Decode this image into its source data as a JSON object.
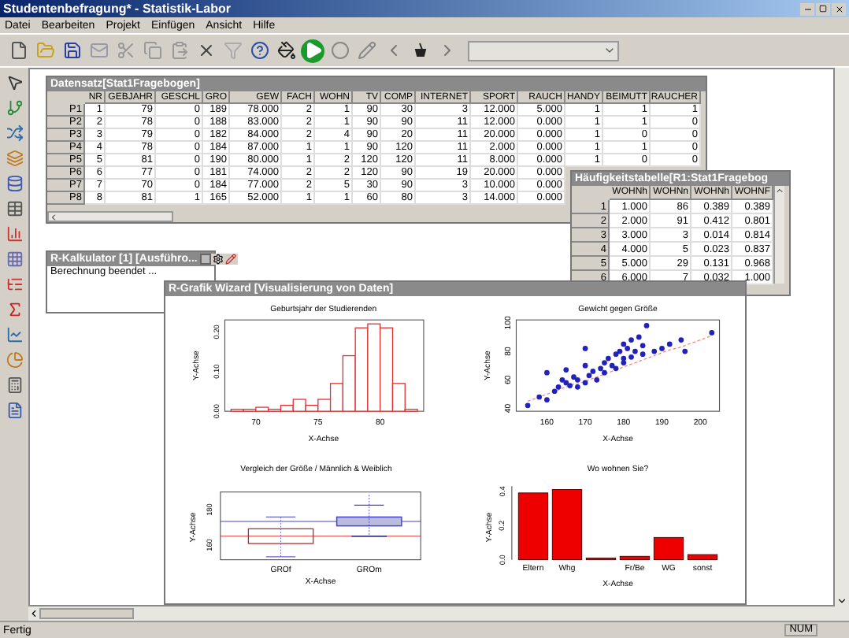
{
  "window": {
    "title": "Studentenbefragung* - Statistik-Labor"
  },
  "menu": [
    "Datei",
    "Bearbeiten",
    "Projekt",
    "Einfügen",
    "Ansicht",
    "Hilfe"
  ],
  "dataset": {
    "title": "Datensatz[Stat1Fragebogen]",
    "columns": [
      "NR",
      "GEBJAHR",
      "GESCHL",
      "GRO",
      "GEW",
      "FACH",
      "WOHN",
      "TV",
      "COMP",
      "INTERNET",
      "SPORT",
      "RAUCH",
      "HANDY",
      "BEIMUTT",
      "RAUCHER"
    ],
    "rows": [
      {
        "label": "P1",
        "cells": [
          "1",
          "79",
          "0",
          "189",
          "78.000",
          "2",
          "1",
          "90",
          "30",
          "3",
          "12.000",
          "5.000",
          "1",
          "1",
          "1"
        ]
      },
      {
        "label": "P2",
        "cells": [
          "2",
          "78",
          "0",
          "188",
          "83.000",
          "2",
          "1",
          "90",
          "90",
          "11",
          "12.000",
          "0.000",
          "1",
          "1",
          "0"
        ]
      },
      {
        "label": "P3",
        "cells": [
          "3",
          "79",
          "0",
          "182",
          "84.000",
          "2",
          "4",
          "90",
          "20",
          "11",
          "20.000",
          "0.000",
          "1",
          "0",
          "0"
        ]
      },
      {
        "label": "P4",
        "cells": [
          "4",
          "78",
          "0",
          "184",
          "87.000",
          "1",
          "1",
          "90",
          "120",
          "11",
          "2.000",
          "0.000",
          "1",
          "1",
          "0"
        ]
      },
      {
        "label": "P5",
        "cells": [
          "5",
          "81",
          "0",
          "190",
          "80.000",
          "1",
          "2",
          "120",
          "120",
          "11",
          "8.000",
          "0.000",
          "1",
          "0",
          "0"
        ]
      },
      {
        "label": "P6",
        "cells": [
          "6",
          "77",
          "0",
          "181",
          "74.000",
          "2",
          "2",
          "120",
          "90",
          "19",
          "20.000",
          "0.000",
          null,
          null,
          null
        ]
      },
      {
        "label": "P7",
        "cells": [
          "7",
          "70",
          "0",
          "184",
          "77.000",
          "2",
          "5",
          "30",
          "90",
          "3",
          "10.000",
          "0.000",
          null,
          null,
          null
        ]
      },
      {
        "label": "P8",
        "cells": [
          "8",
          "81",
          "1",
          "165",
          "52.000",
          "1",
          "1",
          "60",
          "80",
          "3",
          "14.000",
          "0.000",
          null,
          null,
          null
        ]
      }
    ]
  },
  "frequency_table": {
    "title": "Häufigkeitstabelle[R1:Stat1Fragebog",
    "columns": [
      "WOHNh",
      "WOHNn",
      "WOHNh",
      "WOHNF"
    ],
    "rows": [
      {
        "label": "1",
        "cells": [
          "1.000",
          "86",
          "0.389",
          "0.389"
        ]
      },
      {
        "label": "2",
        "cells": [
          "2.000",
          "91",
          "0.412",
          "0.801"
        ]
      },
      {
        "label": "3",
        "cells": [
          "3.000",
          "3",
          "0.014",
          "0.814"
        ]
      },
      {
        "label": "4",
        "cells": [
          "4.000",
          "5",
          "0.023",
          "0.837"
        ]
      },
      {
        "label": "5",
        "cells": [
          "5.000",
          "29",
          "0.131",
          "0.968"
        ]
      },
      {
        "label": "6",
        "cells": [
          "6.000",
          "7",
          "0.032",
          "1.000"
        ]
      }
    ]
  },
  "calculator": {
    "title": "R-Kalkulator [1] [Ausführo...",
    "output": "Berechnung beendet ..."
  },
  "wizard": {
    "title": "R-Grafik Wizard [Visualisierung von Daten]",
    "histogram": {
      "chart_data": {
        "type": "bar",
        "title": "Geburtsjahr der Studierenden",
        "xlabel": "X-Achse",
        "ylabel": "Y-Achse",
        "x": [
          68.5,
          69.5,
          70.5,
          71.5,
          72.5,
          73.5,
          74.5,
          75.5,
          76.5,
          77.5,
          78.5,
          79.5,
          80.5,
          81.5,
          82.5
        ],
        "values": [
          0.005,
          0.005,
          0.01,
          0.005,
          0.015,
          0.03,
          0.015,
          0.03,
          0.07,
          0.14,
          0.21,
          0.22,
          0.21,
          0.07,
          0.005
        ],
        "xlim": [
          67.5,
          83.5
        ],
        "ylim": [
          0,
          0.23
        ],
        "xticks": [
          70,
          75,
          80
        ],
        "yticks": [
          {
            "value": 0,
            "label": "0.00"
          },
          {
            "value": 0.1,
            "label": "0.10"
          },
          {
            "value": 0.2,
            "label": "0.20"
          }
        ]
      }
    },
    "scatter": {
      "chart_data": {
        "type": "scatter",
        "title": "Gewicht gegen Größe",
        "xlabel": "X-Achse",
        "ylabel": "Y-Achse",
        "x": [
          155,
          158,
          160,
          160,
          162,
          163,
          164,
          165,
          165,
          166,
          167,
          168,
          168,
          170,
          170,
          170,
          171,
          172,
          173,
          174,
          175,
          175,
          176,
          177,
          178,
          178,
          179,
          180,
          180,
          180,
          181,
          182,
          182,
          183,
          184,
          185,
          185,
          186,
          188,
          190,
          192,
          195,
          196,
          203
        ],
        "series": [
          {
            "color": "#2222bb",
            "values": [
              42,
              48,
              46,
              65,
              52,
              55,
              60,
              58,
              67,
              56,
              62,
              55,
              60,
              58,
              70,
              82,
              63,
              66,
              60,
              68,
              72,
              65,
              75,
              70,
              78,
              68,
              80,
              75,
              85,
              72,
              82,
              88,
              76,
              80,
              90,
              78,
              84,
              98,
              80,
              82,
              85,
              88,
              80,
              93
            ]
          },
          {
            "type": "line",
            "line_style": "dashed",
            "color": "#ee8888",
            "values": [
              45,
              48,
              50,
              50,
              52,
              53,
              54,
              55,
              55,
              56,
              57,
              57,
              57,
              59,
              59,
              59,
              60,
              61,
              62,
              63,
              64,
              64,
              65,
              66,
              67,
              67,
              68,
              69,
              69,
              69,
              70,
              71,
              71,
              72,
              73,
              74,
              74,
              75,
              77,
              79,
              81,
              83,
              84,
              91
            ]
          }
        ],
        "xlim": [
          152,
          205
        ],
        "ylim": [
          38,
          102
        ],
        "xticks": [
          160,
          170,
          180,
          190,
          200
        ],
        "yticks": [
          40,
          60,
          80,
          100
        ]
      }
    },
    "boxplot": {
      "title": "Vergleich der Größe / Männlich & Weiblich",
      "xlabel": "X-Achse",
      "ylabel": "Y-Achse",
      "yticks": [
        "160",
        "180"
      ],
      "groups": [
        "GROf",
        "GROm"
      ]
    },
    "bars": {
      "chart_data": {
        "type": "bar",
        "title": "Wo wohnen Sie?",
        "xlabel": "X-Achse",
        "ylabel": "Y-Achse",
        "categories": [
          "Eltern",
          "Whg",
          null,
          "Fr/Be",
          "WG",
          "sonst"
        ],
        "values": [
          0.39,
          0.41,
          0.01,
          0.02,
          0.13,
          0.03
        ],
        "ylim": [
          0,
          0.43
        ],
        "yticks": [
          {
            "value": 0,
            "label": "0.0"
          },
          {
            "value": 0.2,
            "label": "0.2"
          },
          {
            "value": 0.4,
            "label": "0.4"
          }
        ]
      }
    }
  },
  "status_bar": {
    "text": "Fertig",
    "indicator": "NUM"
  }
}
